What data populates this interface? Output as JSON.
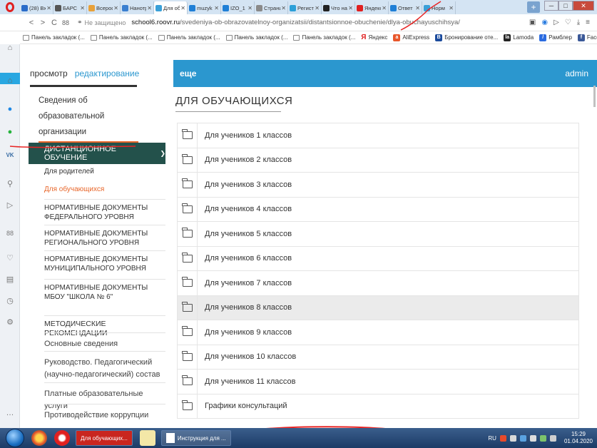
{
  "browser": {
    "tabs": [
      {
        "label": "(28) Вх",
        "color": "#2a6cc9"
      },
      {
        "label": "БАРС",
        "color": "#555555"
      },
      {
        "label": "Всерос",
        "color": "#e8a13a"
      },
      {
        "label": "Нанотр",
        "color": "#3a7fd0"
      },
      {
        "label": "Для об",
        "color": "#3aa0d8",
        "active": true
      },
      {
        "label": "muzyk",
        "color": "#1f7fd6"
      },
      {
        "label": "IZO_1",
        "color": "#1f7fd6"
      },
      {
        "label": "Страни",
        "color": "#8a8a8a"
      },
      {
        "label": "Регист",
        "color": "#2ca0d8"
      },
      {
        "label": "Что на",
        "color": "#222222"
      },
      {
        "label": "Яндекс",
        "color": "#e02020"
      },
      {
        "label": "Ответ",
        "color": "#1f7fd6"
      },
      {
        "label": "Норм",
        "color": "#3aa0d8"
      }
    ],
    "newtab_label": "+",
    "nav": {
      "back": "<",
      "forward": ">",
      "reload": "C",
      "speed_dial": "88"
    },
    "secure_label": "Не защищено",
    "url_host": "school6.roovr.ru",
    "url_path": "/svedeniya-ob-obrazovatelnoy-organizatsii/distantsionnoe-obuchenie/dlya-obuchayuschihsya/",
    "bookmarks": [
      {
        "label": "Панель закладок (...",
        "type": "folder"
      },
      {
        "label": "Панель закладок (...",
        "type": "folder"
      },
      {
        "label": "Панель закладок (...",
        "type": "folder"
      },
      {
        "label": "Панель закладок (...",
        "type": "folder"
      },
      {
        "label": "Панель закладок (...",
        "type": "folder"
      },
      {
        "label": "Яндекс",
        "type": "yandex"
      },
      {
        "label": "AliExpress",
        "type": "ali"
      },
      {
        "label": "Бронирование оте...",
        "type": "booking"
      },
      {
        "label": "Lamoda",
        "type": "lamoda"
      },
      {
        "label": "Рамблер",
        "type": "rambler"
      },
      {
        "label": "Facebook",
        "type": "facebook"
      }
    ],
    "bookmarks_more": "»"
  },
  "site": {
    "view_label": "просмотр",
    "edit_label": "редактирование",
    "more_label": "еще",
    "admin_label": "admin",
    "accent": "#2b97cf",
    "highlight": "#e8662a",
    "dark_section": "#23514b"
  },
  "menu": {
    "org_title": "Сведения об образовательной организации",
    "distance_label": "ДИСТАНЦИОННОЕ ОБУЧЕНИЕ",
    "sub_items": [
      {
        "label": "Для родителей"
      },
      {
        "label": "Для обучающихся",
        "active": true
      },
      {
        "label": "НОРМАТИВНЫЕ ДОКУМЕНТЫ ФЕДЕРАЛЬНОГО УРОВНЯ"
      },
      {
        "label": "НОРМАТИВНЫЕ ДОКУМЕНТЫ РЕГИОНАЛЬНОГО УРОВНЯ"
      },
      {
        "label": "НОРМАТИВНЫЕ ДОКУМЕНТЫ МУНИЦИПАЛЬНОГО УРОВНЯ"
      },
      {
        "label": "НОРМАТИВНЫЕ ДОКУМЕНТЫ МБОУ \"ШКОЛА № 6\""
      },
      {
        "label": "МЕТОДИЧЕСКИЕ РЕКОМЕНДАЦИИ"
      }
    ],
    "main_items": [
      {
        "label": "Основные сведения"
      },
      {
        "label": "Руководство. Педагогический (научно-педагогический) состав"
      },
      {
        "label": "Платные образовательные услуги"
      },
      {
        "label": "Противодействие коррупции"
      }
    ]
  },
  "content": {
    "title": "ДЛЯ ОБУЧАЮЩИХСЯ",
    "folders": [
      {
        "label": "Для учеников 1 классов"
      },
      {
        "label": "Для учеников 2 классов"
      },
      {
        "label": "Для учеников 3 классов"
      },
      {
        "label": "Для учеников 4 классов"
      },
      {
        "label": "Для учеников 5 классов"
      },
      {
        "label": "Для учеников 6 классов"
      },
      {
        "label": "Для учеников 7 классов"
      },
      {
        "label": "Для учеников 8 классов",
        "highlighted": true
      },
      {
        "label": "Для учеников 9 классов"
      },
      {
        "label": "Для учеников 10 классов"
      },
      {
        "label": "Для учеников 11 классов"
      },
      {
        "label": "Графики консультаций"
      }
    ]
  },
  "taskbar": {
    "items": [
      {
        "label": "Для обучающих..."
      },
      {
        "label": "Инструкция для ..."
      }
    ],
    "lang": "RU",
    "time": "15:29",
    "date": "01.04.2020"
  }
}
